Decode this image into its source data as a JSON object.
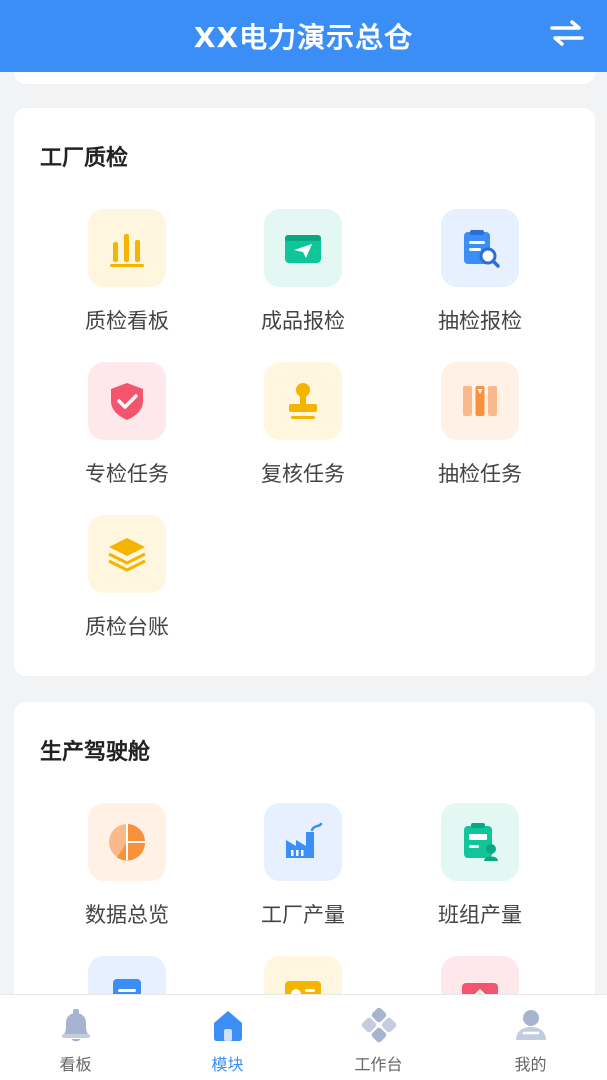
{
  "header": {
    "title": "XX电力演示总仓",
    "action_icon": "swap-arrows-icon"
  },
  "sections": [
    {
      "title": "工厂质检",
      "items": [
        {
          "label": "质检看板",
          "icon": "bar-chart-icon",
          "color": "#f5b400",
          "bg": "#fff6e0"
        },
        {
          "label": "成品报检",
          "icon": "paper-plane-icon",
          "color": "#10c59a",
          "bg": "#e3f8f2"
        },
        {
          "label": "抽检报检",
          "icon": "clipboard-search-icon",
          "color": "#3b8ef6",
          "bg": "#e6f0ff"
        },
        {
          "label": "专检任务",
          "icon": "shield-check-icon",
          "color": "#f3546e",
          "bg": "#ffe8ec"
        },
        {
          "label": "复核任务",
          "icon": "stamp-icon",
          "color": "#f5b400",
          "bg": "#fff6e0"
        },
        {
          "label": "抽检任务",
          "icon": "columns-icon",
          "color": "#f7a35c",
          "bg": "#fff1e6"
        },
        {
          "label": "质检台账",
          "icon": "layers-icon",
          "color": "#f5b400",
          "bg": "#fff6e0"
        }
      ]
    },
    {
      "title": "生产驾驶舱",
      "items": [
        {
          "label": "数据总览",
          "icon": "pie-chart-icon",
          "color": "#f7913a",
          "bg": "#fff1e6"
        },
        {
          "label": "工厂产量",
          "icon": "factory-icon",
          "color": "#3b8ef6",
          "bg": "#e6f0ff"
        },
        {
          "label": "班组产量",
          "icon": "kpi-badge-icon",
          "color": "#10c59a",
          "bg": "#e3f8f2"
        },
        {
          "label": "",
          "icon": "document-icon",
          "color": "#3b8ef6",
          "bg": "#e6f0ff"
        },
        {
          "label": "",
          "icon": "screen-icon",
          "color": "#f5b400",
          "bg": "#fff6e0"
        },
        {
          "label": "",
          "icon": "envelope-icon",
          "color": "#f3546e",
          "bg": "#ffe8ec"
        }
      ]
    }
  ],
  "bottom_nav": {
    "items": [
      {
        "label": "看板",
        "icon": "bell-icon",
        "active": false
      },
      {
        "label": "模块",
        "icon": "home-icon",
        "active": true
      },
      {
        "label": "工作台",
        "icon": "clover-icon",
        "active": false
      },
      {
        "label": "我的",
        "icon": "user-icon",
        "active": false
      }
    ],
    "active_color": "#3b8ef6",
    "inactive_color": "#a7b4cf"
  }
}
